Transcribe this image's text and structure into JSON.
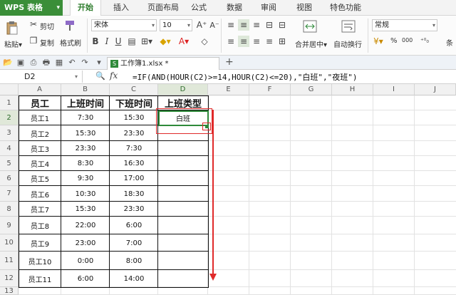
{
  "menubar": {
    "app_label": "WPS 表格",
    "items": [
      {
        "label": "开始",
        "active": true
      },
      {
        "label": "插入"
      },
      {
        "label": "页面布局"
      },
      {
        "label": "公式"
      },
      {
        "label": "数据"
      },
      {
        "label": "审阅"
      },
      {
        "label": "视图"
      },
      {
        "label": "特色功能"
      }
    ]
  },
  "ribbon": {
    "paste_label": "粘贴",
    "cut_label": "剪切",
    "copy_label": "复制",
    "format_painter_label": "格式刷",
    "font_name": "宋体",
    "font_size": "10",
    "merge_center_label": "合并居中",
    "wrap_text_label": "自动换行",
    "number_format": "常规",
    "percent_symbol": "%",
    "comma_symbol": "000",
    "condition_label": "条"
  },
  "doc": {
    "tab_title": "工作簿1.xlsx *"
  },
  "formula_bar": {
    "cell_ref": "D2",
    "fx": "fx",
    "formula": "=IF(AND(HOUR(C2)>=14,HOUR(C2)<=20),\"白班\",\"夜班\")"
  },
  "sheet": {
    "columns": [
      "A",
      "B",
      "C",
      "D",
      "E",
      "F",
      "G",
      "H",
      "I",
      "J"
    ],
    "rows": [
      "1",
      "2",
      "3",
      "4",
      "5",
      "6",
      "7",
      "8",
      "9",
      "10",
      "11",
      "12",
      "13"
    ],
    "headers": [
      "员工",
      "上班时间",
      "下班时间",
      "上班类型"
    ],
    "data": [
      [
        "员工1",
        "7:30",
        "15:30",
        "白班"
      ],
      [
        "员工2",
        "15:30",
        "23:30",
        ""
      ],
      [
        "员工3",
        "23:30",
        "7:30",
        ""
      ],
      [
        "员工4",
        "8:30",
        "16:30",
        ""
      ],
      [
        "员工5",
        "9:30",
        "17:00",
        ""
      ],
      [
        "员工6",
        "10:30",
        "18:30",
        ""
      ],
      [
        "员工7",
        "15:30",
        "23:30",
        ""
      ],
      [
        "员工8",
        "22:00",
        "6:00",
        ""
      ],
      [
        "员工9",
        "23:00",
        "7:00",
        ""
      ],
      [
        "员工10",
        "0:00",
        "8:00",
        ""
      ],
      [
        "员工11",
        "6:00",
        "14:00",
        ""
      ]
    ]
  },
  "colors": {
    "accent": "#2f8a3a",
    "annotation": "#e02a2a"
  },
  "icons": [
    "cut-icon",
    "copy-icon",
    "format-painter-icon",
    "paste-icon",
    "bold-icon",
    "italic-icon",
    "underline-icon",
    "fx-icon",
    "zoom-icon"
  ]
}
